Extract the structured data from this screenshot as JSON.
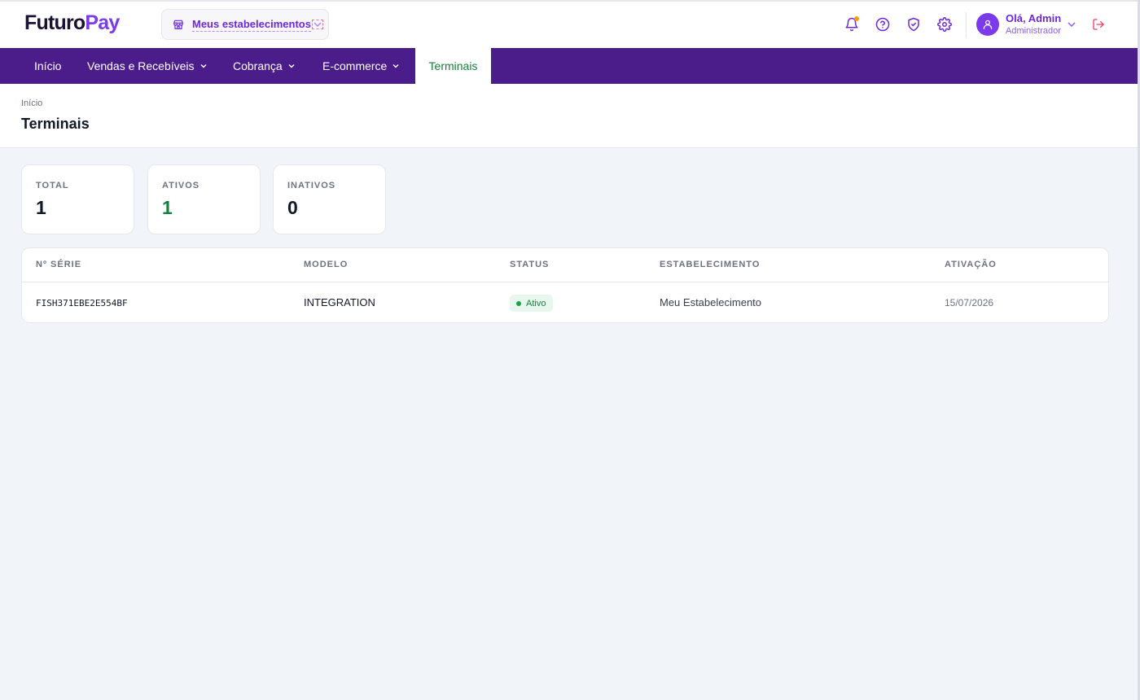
{
  "brand": {
    "part1": "Futuro",
    "part2": "Pay",
    "accent": "#7c3aed"
  },
  "establishment_selector": {
    "label": "Meus estabelecimentos",
    "icon": "store-icon"
  },
  "header_icons": [
    "bell-icon",
    "help-circle-icon",
    "shield-check-icon",
    "gear-icon"
  ],
  "user": {
    "greeting": "Olá, Admin",
    "role": "Administrador"
  },
  "nav": {
    "items": [
      {
        "label": "Início",
        "has_menu": false
      },
      {
        "label": "Vendas e Recebíveis",
        "has_menu": true
      },
      {
        "label": "Cobrança",
        "has_menu": true
      },
      {
        "label": "E-commerce",
        "has_menu": true
      },
      {
        "label": "Terminais",
        "has_menu": false,
        "active": true
      }
    ],
    "background": "#4a1d8a"
  },
  "page": {
    "breadcrumb": "Início",
    "title": "Terminais"
  },
  "stats": [
    {
      "label": "TOTAL",
      "value": "1"
    },
    {
      "label": "ATIVOS",
      "value": "1"
    },
    {
      "label": "INATIVOS",
      "value": "0"
    }
  ],
  "table": {
    "columns": [
      "Nº SÉRIE",
      "MODELO",
      "STATUS",
      "ESTABELECIMENTO",
      "ATIVAÇÃO"
    ],
    "rows": [
      {
        "serial": "FISH371EBE2E554BF",
        "model": "INTEGRATION",
        "status": "Ativo",
        "establishment": "Meu Estabelecimento",
        "activation": "15/07/2026"
      }
    ]
  }
}
